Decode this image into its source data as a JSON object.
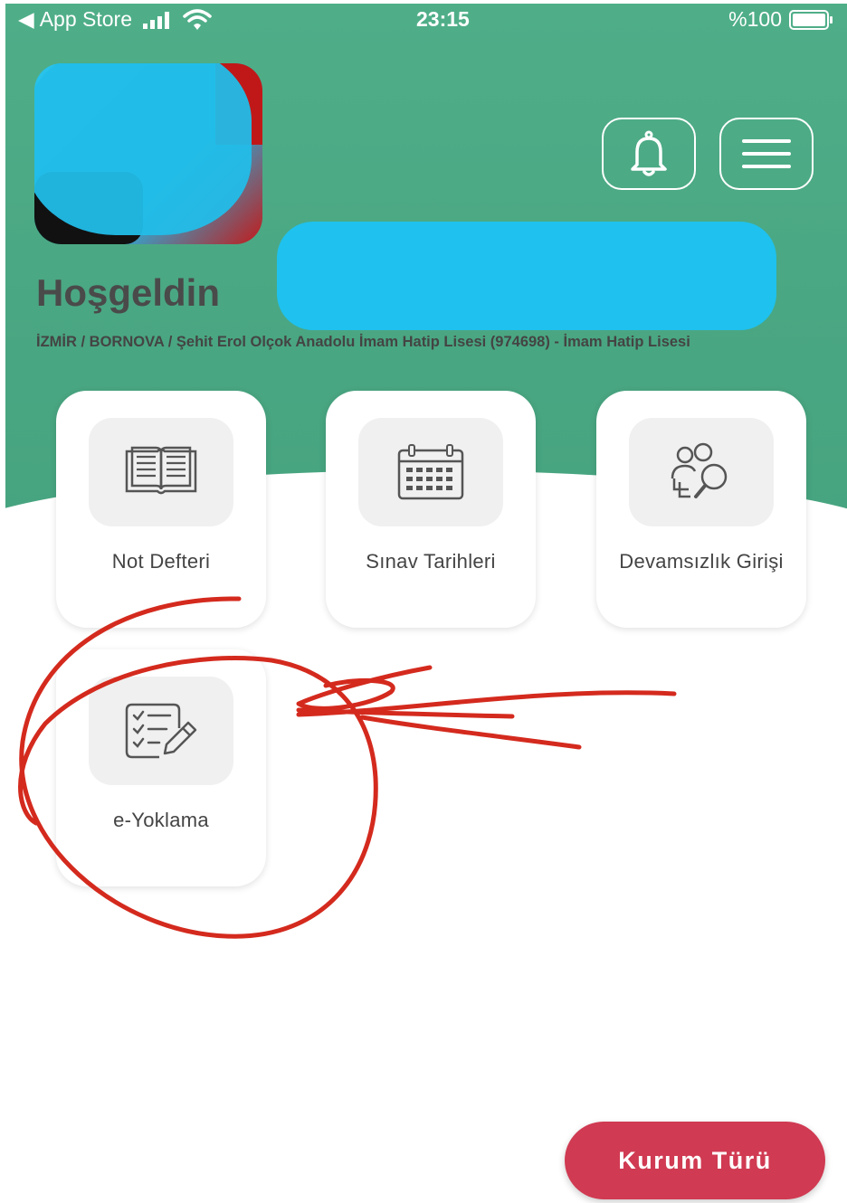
{
  "status_bar": {
    "back_label": "App Store",
    "time": "23:15",
    "battery": "%100"
  },
  "header": {
    "welcome": "Hoşgeldin",
    "school": "İZMİR / BORNOVA / Şehit Erol Olçok Anadolu İmam Hatip Lisesi (974698) - İmam Hatip Lisesi"
  },
  "menu": [
    {
      "label": "Not Defteri",
      "icon": "book-icon"
    },
    {
      "label": "Sınav Tarihleri",
      "icon": "calendar-icon"
    },
    {
      "label": "Devamsızlık Girişi",
      "icon": "users-search-icon"
    },
    {
      "label": "e-Yoklama",
      "icon": "checklist-edit-icon"
    }
  ],
  "fab": {
    "label": "Kurum Türü"
  },
  "colors": {
    "header_green": "#4fae88",
    "fab_red": "#d03a52",
    "annotation_red": "#d42a1e"
  }
}
